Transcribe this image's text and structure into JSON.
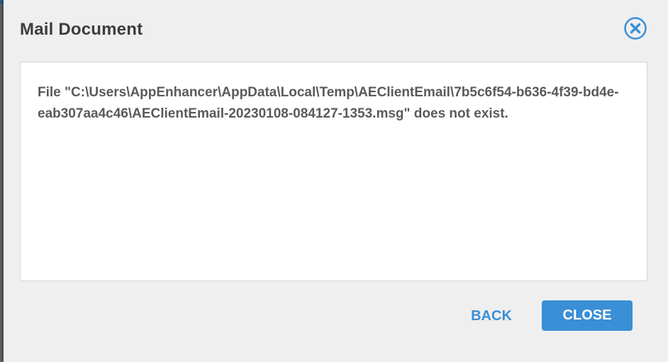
{
  "dialog": {
    "title": "Mail Document",
    "close_icon": "close-circle-icon",
    "message": "File \"C:\\Users\\AppEnhancer\\AppData\\Local\\Temp\\AEClientEmail\\7b5c6f54-b636-4f39-bd4e-eab307aa4c46\\AEClientEmail-20230108-084127-1353.msg\" does not exist.",
    "buttons": {
      "back_label": "BACK",
      "close_label": "CLOSE"
    }
  },
  "colors": {
    "accent": "#3a8fd6",
    "dialog_background": "#efefef",
    "message_background": "#ffffff",
    "title_text": "#3d3d3d",
    "message_text": "#5a5a5a"
  }
}
